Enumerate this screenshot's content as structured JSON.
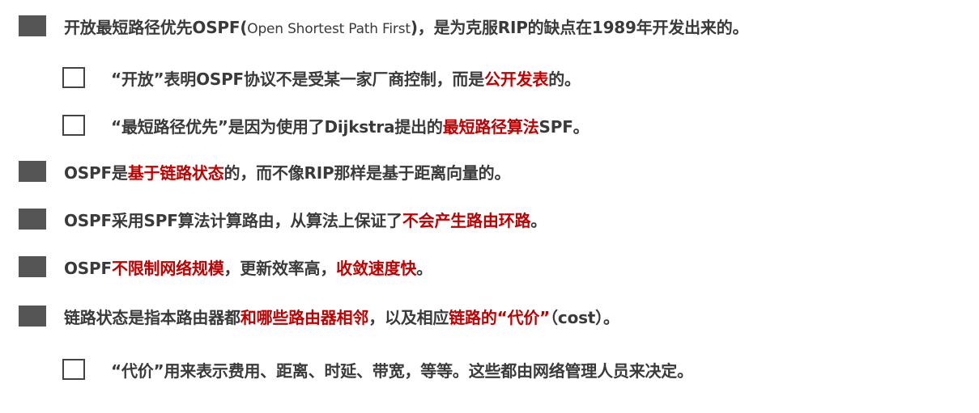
{
  "colors": {
    "text": "#3a3a3a",
    "highlight": "#c00000",
    "marker": "#555555"
  },
  "items": [
    {
      "level": 1,
      "segments": [
        {
          "text": "开放最短路径优先OSPF(",
          "hl": false
        },
        {
          "text": "Open Shortest Path First",
          "hl": false,
          "small": true
        },
        {
          "text": ")，是为克服RIP的缺点在1989年开发出来的。",
          "hl": false
        }
      ]
    },
    {
      "level": 2,
      "segments": [
        {
          "text": "“开放”表明OSPF协议不是受某一家厂商控制，而是",
          "hl": false
        },
        {
          "text": "公开发表",
          "hl": true
        },
        {
          "text": "的。",
          "hl": false
        }
      ]
    },
    {
      "level": 2,
      "segments": [
        {
          "text": "“最短路径优先”是因为使用了Dijkstra提出的",
          "hl": false
        },
        {
          "text": "最短路径算法",
          "hl": true
        },
        {
          "text": "SPF。",
          "hl": false
        }
      ]
    },
    {
      "level": 1,
      "segments": [
        {
          "text": "OSPF是",
          "hl": false
        },
        {
          "text": "基于链路状态",
          "hl": true
        },
        {
          "text": "的，而不像RIP那样是基于距离向量的。",
          "hl": false
        }
      ]
    },
    {
      "level": 1,
      "segments": [
        {
          "text": "OSPF采用SPF算法计算路由，从算法上保证了",
          "hl": false
        },
        {
          "text": "不会产生路由环路",
          "hl": true
        },
        {
          "text": "。",
          "hl": false
        }
      ]
    },
    {
      "level": 1,
      "segments": [
        {
          "text": "OSPF",
          "hl": false
        },
        {
          "text": "不限制网络规模",
          "hl": true
        },
        {
          "text": "，更新效率高，",
          "hl": false
        },
        {
          "text": "收敛速度快",
          "hl": true
        },
        {
          "text": "。",
          "hl": false
        }
      ]
    },
    {
      "level": 1,
      "segments": [
        {
          "text": "链路状态是指本路由器都",
          "hl": false
        },
        {
          "text": "和哪些路由器相邻",
          "hl": true
        },
        {
          "text": "，以及相应",
          "hl": false
        },
        {
          "text": "链路的“代价”",
          "hl": true
        },
        {
          "text": "（cost）。",
          "hl": false
        }
      ]
    },
    {
      "level": 2,
      "segments": [
        {
          "text": "“代价”用来表示费用、距离、时延、带宽，等等。这些都由网络管理人员来决定。",
          "hl": false
        }
      ]
    }
  ]
}
